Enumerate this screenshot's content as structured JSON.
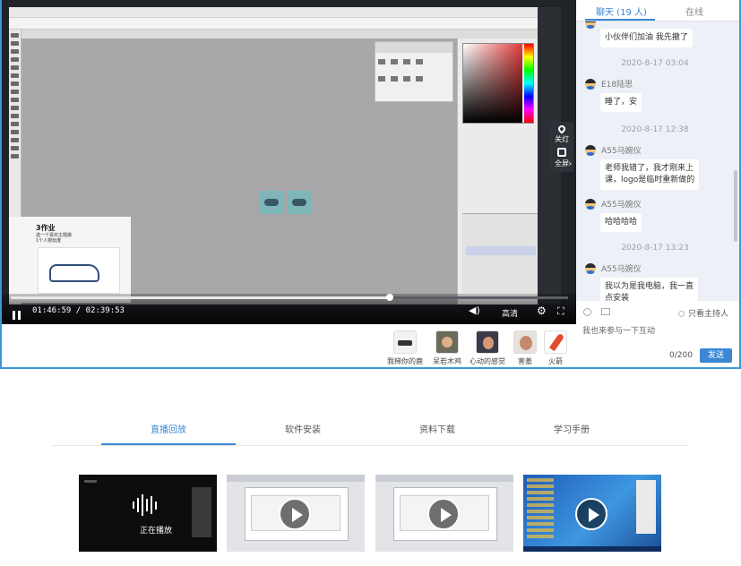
{
  "video": {
    "workcard_title": "3作业",
    "workcard_line1": "选一个喜欢主题做",
    "workcard_line2": "1个人物玩度",
    "side_controls": {
      "light": "关灯",
      "fullscreen": "全屏"
    },
    "controls": {
      "time": "01:46:59 / 02:39:53",
      "progress": 0.68,
      "quality": "高清"
    }
  },
  "chat": {
    "tabs": [
      {
        "label": "聊天 (19 人)"
      },
      {
        "label": "在线"
      }
    ],
    "messages": [
      {
        "text": "小伙伴们加油 我先撤了"
      },
      {
        "stamp": "2020-8-17 03:04"
      },
      {
        "user": "E18陆思",
        "text": "睡了，安"
      },
      {
        "stamp": "2020-8-17 12:38"
      },
      {
        "user": "A55马婉仪",
        "text_lines": [
          "老师我错了，我才刚来上",
          "课，logo是临时重新做的"
        ]
      },
      {
        "user": "A55马婉仪",
        "text": "哈哈哈哈"
      },
      {
        "stamp": "2020-8-17 13:23"
      },
      {
        "user": "A55马婉仪",
        "text_lines": [
          "我以为是我电脑，我一直",
          "点安装"
        ]
      }
    ],
    "input": {
      "host_only": "只看主持人",
      "placeholder": "我也来参与一下互动",
      "counter": "0/200",
      "send": "发送"
    }
  },
  "gifts": [
    {
      "label": "我梯你的鹿"
    },
    {
      "label": "呆若木鸡"
    },
    {
      "label": "心动的感觉"
    },
    {
      "label": "害羞"
    },
    {
      "label": "火箭"
    }
  ],
  "lower": {
    "tabs": [
      {
        "label": "直播回放"
      },
      {
        "label": "软件安装"
      },
      {
        "label": "资料下载"
      },
      {
        "label": "学习手册"
      }
    ],
    "cards": [
      {
        "label": "正在播放"
      }
    ]
  },
  "colors": {
    "accent": "#3b87d6",
    "top_border": "#3a9ad9"
  }
}
